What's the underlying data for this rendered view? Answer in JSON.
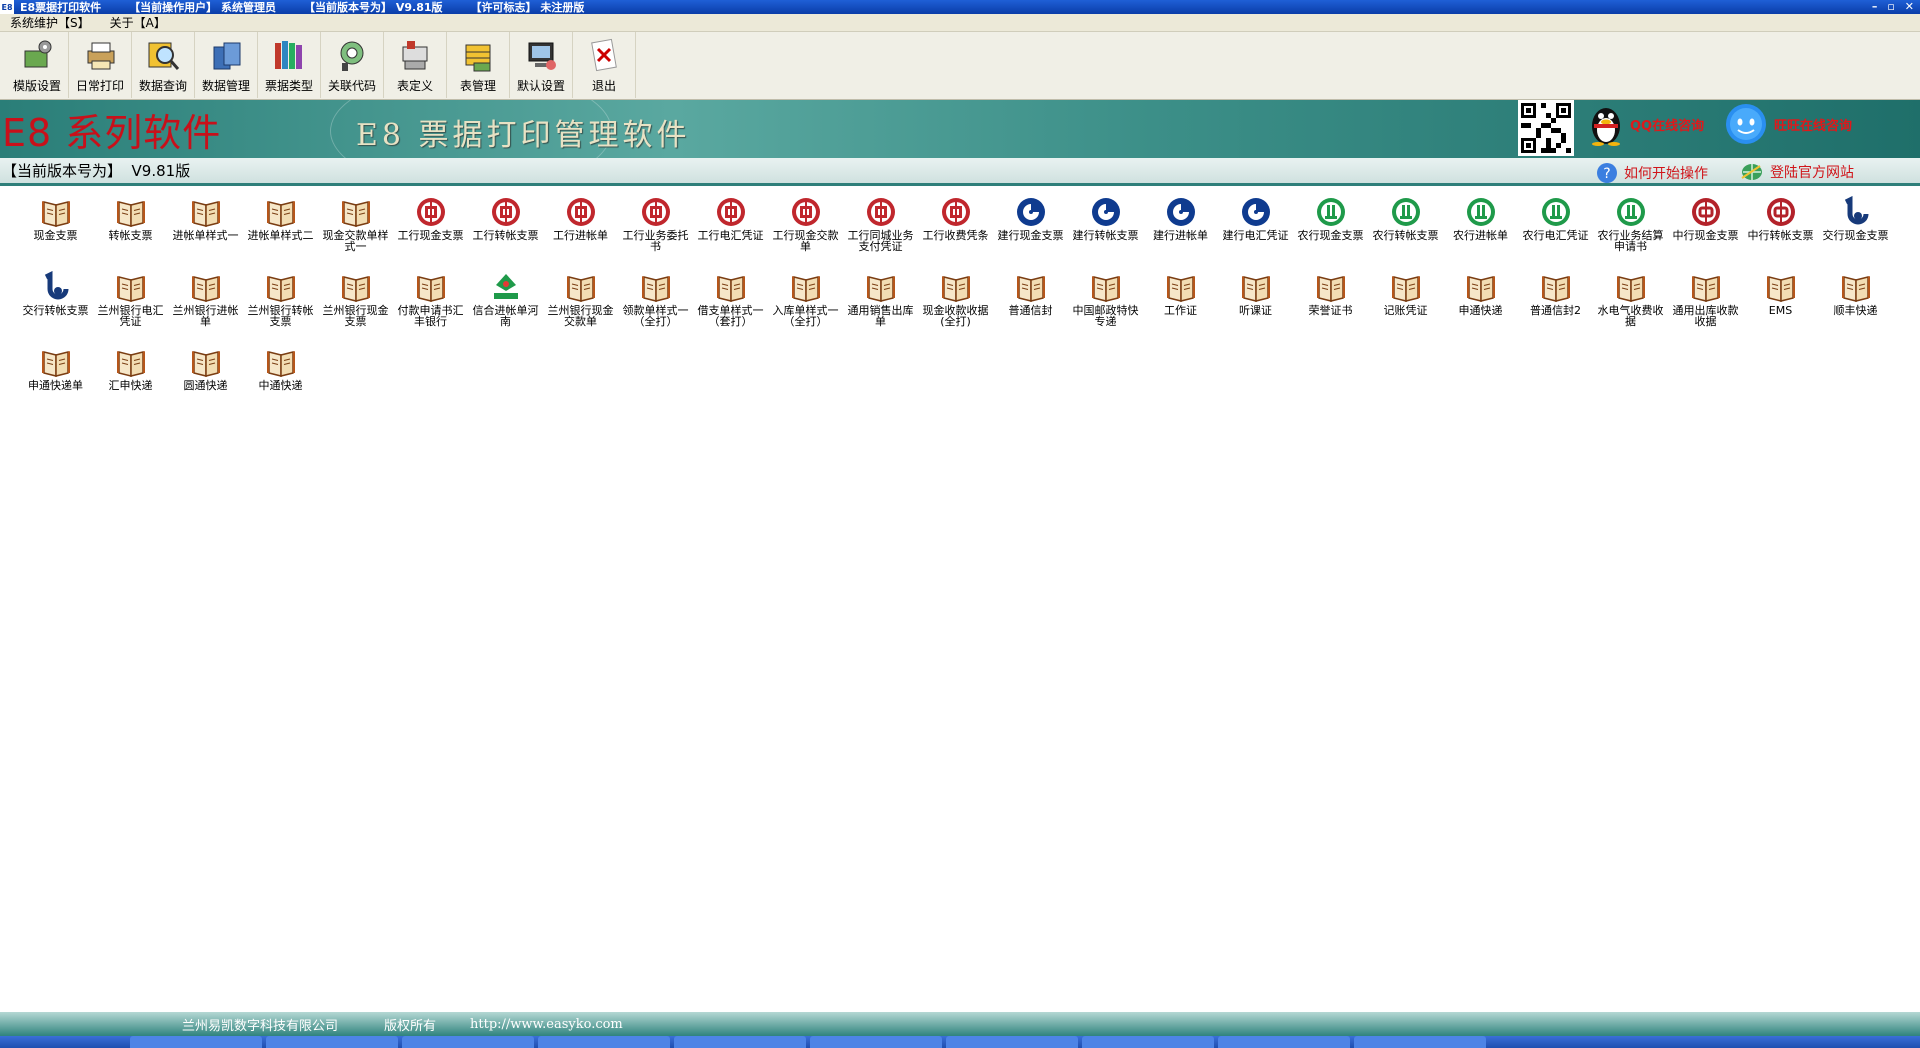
{
  "titlebar": {
    "app_name": "E8票据打印软件",
    "current_user": "【当前操作用户】 系统管理员",
    "current_version": "【当前版本号为】 V9.81版",
    "license": "【许可标志】 未注册版"
  },
  "menu": [
    "系统维护【S】",
    "关于【A】"
  ],
  "toolbar": [
    {
      "label": "模版设置",
      "icon": "template-settings-icon"
    },
    {
      "label": "日常打印",
      "icon": "printer-icon"
    },
    {
      "label": "数据查询",
      "icon": "search-icon"
    },
    {
      "label": "数据管理",
      "icon": "database-icon"
    },
    {
      "label": "票据类型",
      "icon": "books-icon"
    },
    {
      "label": "关联代码",
      "icon": "link-code-icon"
    },
    {
      "label": "表定义",
      "icon": "table-define-icon"
    },
    {
      "label": "表管理",
      "icon": "table-manage-icon"
    },
    {
      "label": "默认设置",
      "icon": "default-settings-icon"
    },
    {
      "label": "退出",
      "icon": "exit-icon"
    }
  ],
  "banner": {
    "brand": "E8 系列软件",
    "product": "E8 票据打印管理软件",
    "contact1": "QQ在线咨询",
    "contact2": "旺旺在线咨询"
  },
  "version_bar": {
    "text": "【当前版本号为】  V9.81版",
    "help_link": "如何开始操作",
    "site_link": "登陆官方网站"
  },
  "grid_items": [
    {
      "label": "现金支票",
      "icon": "book"
    },
    {
      "label": "转帐支票",
      "icon": "book"
    },
    {
      "label": "进帐单样式一",
      "icon": "book"
    },
    {
      "label": "进帐单样式二",
      "icon": "book"
    },
    {
      "label": "现金交款单样式一",
      "icon": "book"
    },
    {
      "label": "工行现金支票",
      "icon": "icbc"
    },
    {
      "label": "工行转帐支票",
      "icon": "icbc"
    },
    {
      "label": "工行进帐单",
      "icon": "icbc"
    },
    {
      "label": "工行业务委托书",
      "icon": "icbc"
    },
    {
      "label": "工行电汇凭证",
      "icon": "icbc"
    },
    {
      "label": "工行现金交款单",
      "icon": "icbc"
    },
    {
      "label": "工行同城业务支付凭证",
      "icon": "icbc"
    },
    {
      "label": "工行收费凭条",
      "icon": "icbc"
    },
    {
      "label": "建行现金支票",
      "icon": "ccb"
    },
    {
      "label": "建行转帐支票",
      "icon": "ccb"
    },
    {
      "label": "建行进帐单",
      "icon": "ccb"
    },
    {
      "label": "建行电汇凭证",
      "icon": "ccb"
    },
    {
      "label": "农行现金支票",
      "icon": "abc"
    },
    {
      "label": "农行转帐支票",
      "icon": "abc"
    },
    {
      "label": "农行进帐单",
      "icon": "abc"
    },
    {
      "label": "农行电汇凭证",
      "icon": "abc"
    },
    {
      "label": "农行业务结算申请书",
      "icon": "abc"
    },
    {
      "label": "中行现金支票",
      "icon": "boc"
    },
    {
      "label": "中行转帐支票",
      "icon": "boc"
    },
    {
      "label": "交行现金支票",
      "icon": "bocom"
    },
    {
      "label": "交行转帐支票",
      "icon": "bocom"
    },
    {
      "label": "兰州银行电汇凭证",
      "icon": "book"
    },
    {
      "label": "兰州银行进帐单",
      "icon": "book"
    },
    {
      "label": "兰州银行转帐支票",
      "icon": "book"
    },
    {
      "label": "兰州银行现金支票",
      "icon": "book"
    },
    {
      "label": "付款申请书汇丰银行",
      "icon": "book"
    },
    {
      "label": "信合进帐单河南",
      "icon": "rcc"
    },
    {
      "label": "兰州银行现金交款单",
      "icon": "book"
    },
    {
      "label": "领款单样式一（全打）",
      "icon": "book"
    },
    {
      "label": "借支单样式一（套打）",
      "icon": "book"
    },
    {
      "label": "入库单样式一（全打）",
      "icon": "book"
    },
    {
      "label": "通用销售出库单",
      "icon": "book"
    },
    {
      "label": "现金收款收据(全打)",
      "icon": "book"
    },
    {
      "label": "普通信封",
      "icon": "book"
    },
    {
      "label": "中国邮政特快专递",
      "icon": "book"
    },
    {
      "label": "工作证",
      "icon": "book"
    },
    {
      "label": "听课证",
      "icon": "book"
    },
    {
      "label": "荣誉证书",
      "icon": "book"
    },
    {
      "label": "记账凭证",
      "icon": "book"
    },
    {
      "label": "申通快递",
      "icon": "book"
    },
    {
      "label": "普通信封2",
      "icon": "book"
    },
    {
      "label": "水电气收费收据",
      "icon": "book"
    },
    {
      "label": "通用出库收款收据",
      "icon": "book"
    },
    {
      "label": "EMS",
      "icon": "book"
    },
    {
      "label": "顺丰快递",
      "icon": "book"
    },
    {
      "label": "申通快递单",
      "icon": "book"
    },
    {
      "label": "汇申快递",
      "icon": "book"
    },
    {
      "label": "圆通快递",
      "icon": "book"
    },
    {
      "label": "中通快递",
      "icon": "book"
    }
  ],
  "footer": {
    "company": "兰州易凯数字科技有限公司",
    "rights": "版权所有",
    "url": "http://www.easyko.com"
  },
  "colors": {
    "icbc": "#c0272d",
    "ccb": "#0f3b8f",
    "abc": "#1f9a4a",
    "boc": "#b3222a",
    "bocom": "#173a7a",
    "banner": "#2a7e78",
    "brand": "#c8101a"
  }
}
